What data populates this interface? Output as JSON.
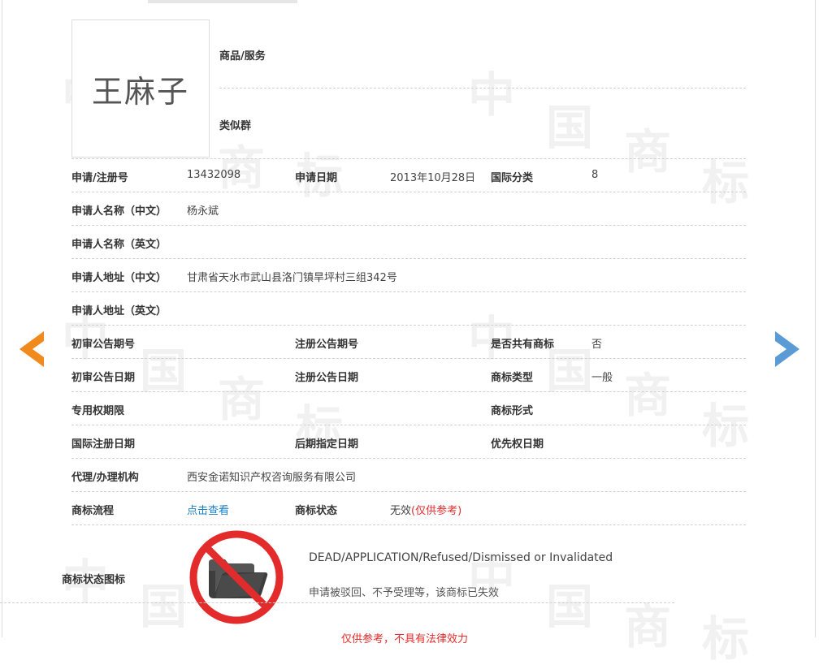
{
  "watermark": {
    "chars": [
      "中",
      "国",
      "商",
      "标"
    ]
  },
  "trademark": {
    "image_text": "王麻子",
    "goods_label": "商品/服务",
    "similar_group_label": "类似群"
  },
  "fields": {
    "reg_no": {
      "label": "申请/注册号",
      "value": "13432098"
    },
    "app_date": {
      "label": "申请日期",
      "value": "2013年10月28日"
    },
    "intl_class": {
      "label": "国际分类",
      "value": "8"
    },
    "applicant_cn": {
      "label": "申请人名称（中文）",
      "value": "杨永斌"
    },
    "applicant_en": {
      "label": "申请人名称（英文）",
      "value": ""
    },
    "address_cn": {
      "label": "申请人地址（中文）",
      "value": "甘肃省天水市武山县洛门镇旱坪村三组342号"
    },
    "address_en": {
      "label": "申请人地址（英文）",
      "value": ""
    },
    "prelim_pub_no": {
      "label": "初审公告期号",
      "value": ""
    },
    "reg_pub_no": {
      "label": "注册公告期号",
      "value": ""
    },
    "shared": {
      "label": "是否共有商标",
      "value": "否"
    },
    "prelim_pub_date": {
      "label": "初审公告日期",
      "value": ""
    },
    "reg_pub_date": {
      "label": "注册公告日期",
      "value": ""
    },
    "tm_type": {
      "label": "商标类型",
      "value": "一般"
    },
    "exclusive_period": {
      "label": "专用权期限",
      "value": ""
    },
    "tm_form": {
      "label": "商标形式",
      "value": ""
    },
    "intl_reg_date": {
      "label": "国际注册日期",
      "value": ""
    },
    "later_designation_date": {
      "label": "后期指定日期",
      "value": ""
    },
    "priority_date": {
      "label": "优先权日期",
      "value": ""
    },
    "agent": {
      "label": "代理/办理机构",
      "value": "西安金诺知识产权咨询服务有限公司"
    },
    "flow": {
      "label": "商标流程",
      "link": "点击查看"
    },
    "status": {
      "label": "商标状态",
      "value": "无效",
      "note": "(仅供参考)"
    }
  },
  "status_icon": {
    "label": "商标状态图标",
    "icon": "folder-prohibited-icon",
    "en_text": "DEAD/APPLICATION/Refused/Dismissed or Invalidated",
    "cn_text": "申请被驳回、不予受理等，该商标已失效"
  },
  "disclaimer": "仅供参考，不具有法律效力",
  "nav": {
    "prev_icon": "arrow-left-icon",
    "next_icon": "arrow-right-icon"
  },
  "colors": {
    "accent_link": "#1a7fc4",
    "warning_red": "#e52b2b",
    "prev_arrow": "#f08a1c",
    "next_arrow": "#5b9bd5"
  }
}
